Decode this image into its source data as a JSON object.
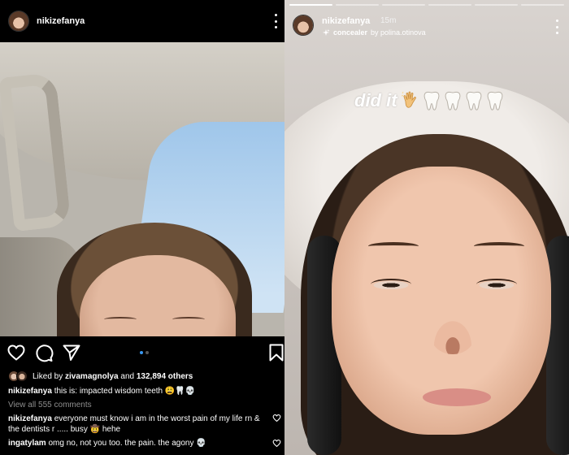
{
  "post": {
    "username": "nikizefanya",
    "liked_by_prefix": "Liked by",
    "liked_by_user": "zivamagnolya",
    "liked_by_and": "and",
    "likes_count": "132,894 others",
    "caption_user": "nikizefanya",
    "caption_text": "this is: impacted wisdom teeth 😩🦷💀",
    "view_all_comments": "View all 555 comments",
    "comments": [
      {
        "user": "nikizefanya",
        "text": "everyone must know i am in the worst pain of my life rn & the dentists r ..... busy 🤠 hehe"
      },
      {
        "user": "ingatylam",
        "text": "omg no, not you too. the pain. the agony 💀"
      }
    ],
    "carousel": {
      "current": 1,
      "total": 2
    }
  },
  "story": {
    "username": "nikizefanya",
    "time": "15m",
    "effect_name": "concealer",
    "effect_by": "by polina.otinova",
    "overlay_text": "did it",
    "overlay_emojis": [
      "waving-hand-emoji",
      "tooth-emoji",
      "tooth-emoji",
      "tooth-emoji",
      "tooth-emoji"
    ],
    "segments_total": 6,
    "segments_done": 1
  },
  "colors": {
    "background": "#000000",
    "link_blue": "#3897f0",
    "muted_text": "#8e8e8e"
  }
}
